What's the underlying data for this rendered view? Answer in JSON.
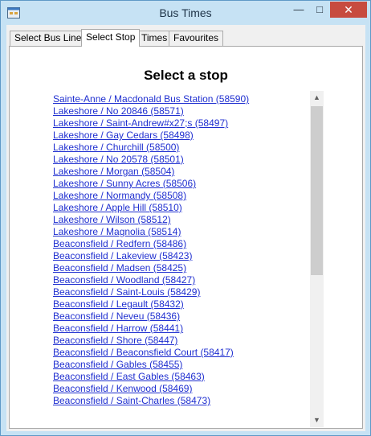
{
  "window": {
    "title": "Bus Times"
  },
  "titlebar_controls": {
    "minimize": "—",
    "maximize": "□",
    "close": "✕"
  },
  "tabs": [
    {
      "label": "Select Bus Line",
      "active": false
    },
    {
      "label": "Select Stop",
      "active": true
    },
    {
      "label": "Times",
      "active": false
    },
    {
      "label": "Favourites",
      "active": false
    }
  ],
  "main": {
    "heading": "Select a stop",
    "stops": [
      "Sainte-Anne / Macdonald Bus Station (58590)",
      "Lakeshore / No 20846 (58571)",
      "Lakeshore / Saint-Andrew#x27;s (58497)",
      "Lakeshore / Gay Cedars (58498)",
      "Lakeshore / Churchill (58500)",
      "Lakeshore / No 20578 (58501)",
      "Lakeshore / Morgan (58504)",
      "Lakeshore / Sunny Acres (58506)",
      "Lakeshore / Normandy (58508)",
      "Lakeshore / Apple Hill (58510)",
      "Lakeshore / Wilson (58512)",
      "Lakeshore / Magnolia (58514)",
      "Beaconsfield / Redfern (58486)",
      "Beaconsfield / Lakeview (58423)",
      "Beaconsfield / Madsen (58425)",
      "Beaconsfield / Woodland (58427)",
      "Beaconsfield / Saint-Louis (58429)",
      "Beaconsfield / Legault (58432)",
      "Beaconsfield / Neveu (58436)",
      "Beaconsfield / Harrow (58441)",
      "Beaconsfield / Shore (58447)",
      "Beaconsfield / Beaconsfield Court (58417)",
      "Beaconsfield / Gables (58455)",
      "Beaconsfield / East Gables (58463)",
      "Beaconsfield / Kenwood (58469)",
      "Beaconsfield / Saint-Charles (58473)"
    ]
  },
  "scrollbar": {
    "up_icon": "▲",
    "down_icon": "▼"
  },
  "colors": {
    "link": "#1f2fd0",
    "close_button": "#c74b3f",
    "window_frame": "#c6e2f4"
  }
}
